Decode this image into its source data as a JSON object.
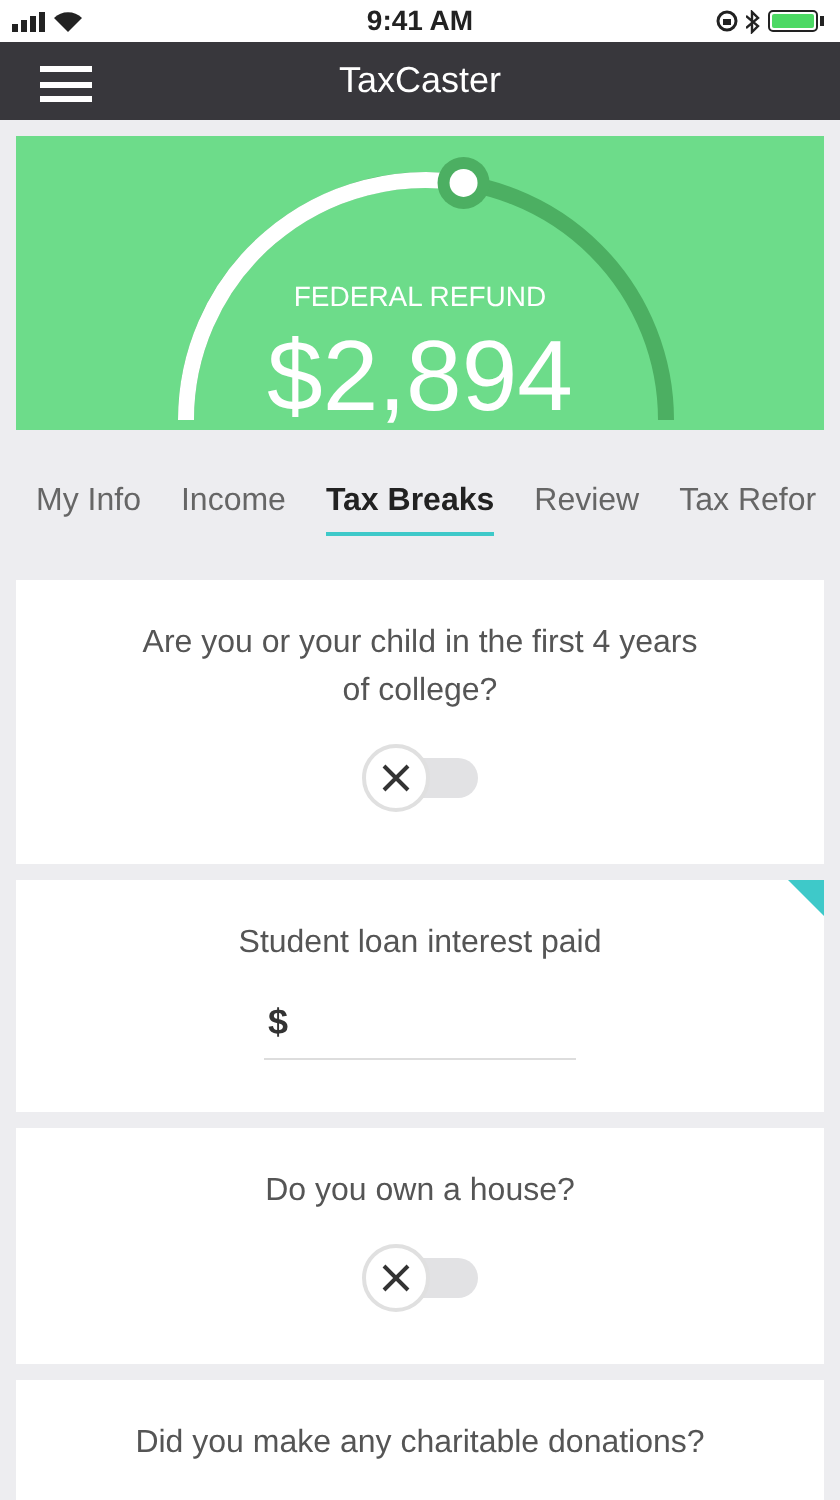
{
  "status_bar": {
    "time": "9:41 AM"
  },
  "nav": {
    "title": "TaxCaster"
  },
  "refund": {
    "label": "FEDERAL REFUND",
    "amount": "$2,894"
  },
  "tabs": [
    {
      "label": "My Info",
      "selected": false
    },
    {
      "label": "Income",
      "selected": false
    },
    {
      "label": "Tax Breaks",
      "selected": true
    },
    {
      "label": "Review",
      "selected": false
    },
    {
      "label": "Tax Refor",
      "selected": false
    }
  ],
  "questions": [
    {
      "kind": "toggle",
      "text": "Are you or your child in the first 4 years of college?",
      "on": false,
      "flagged": false
    },
    {
      "kind": "amount",
      "text": "Student loan interest paid",
      "currency": "$",
      "flagged": true
    },
    {
      "kind": "toggle",
      "text": "Do you own a house?",
      "on": false,
      "flagged": false
    },
    {
      "kind": "question",
      "text": "Did you make any charitable donations?",
      "flagged": false
    }
  ]
}
